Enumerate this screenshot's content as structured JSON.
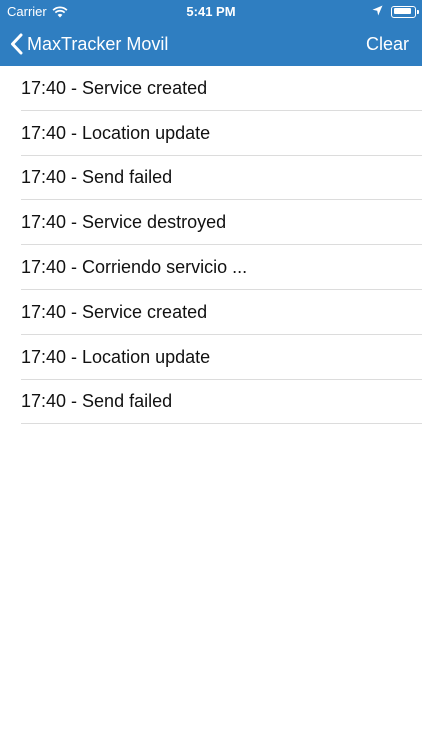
{
  "status_bar": {
    "carrier": "Carrier",
    "time": "5:41 PM"
  },
  "nav": {
    "back_label": "MaxTracker Movil",
    "clear_label": "Clear"
  },
  "log": {
    "items": [
      "17:40 - Service created",
      "17:40 - Location update",
      "17:40 - Send failed",
      "17:40 - Service destroyed",
      "17:40 - Corriendo servicio ...",
      "17:40 - Service created",
      "17:40 - Location update",
      "17:40 - Send failed"
    ]
  },
  "colors": {
    "header": "#2f7ec1",
    "separator": "#dcdcdc"
  }
}
